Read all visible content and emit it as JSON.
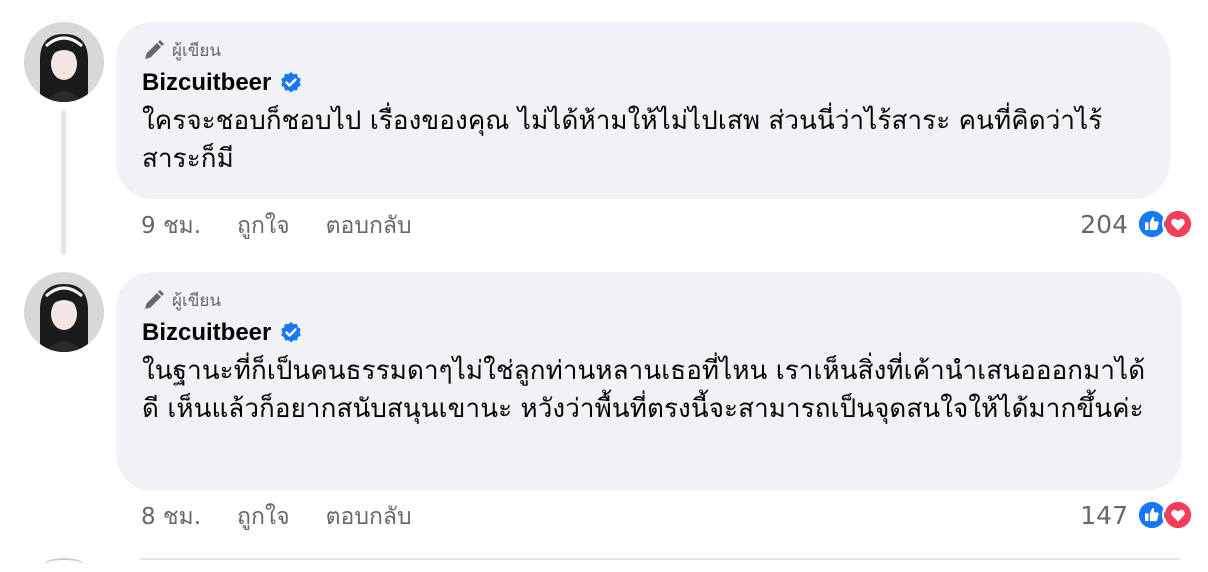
{
  "comments": [
    {
      "badge": "ผู้เขียน",
      "author": "Bizcuitbeer",
      "text": "ใครจะชอบก็ชอบไป เรื่องของคุณ ไม่ได้ห้ามให้ไม่ไปเสพ ส่วนนี่ว่าไร้สาระ คนที่คิดว่าไร้สาระก็มี",
      "time": "9 ชม.",
      "like": "ถูกใจ",
      "reply": "ตอบกลับ",
      "reaction_count": "204"
    },
    {
      "badge": "ผู้เขียน",
      "author": "Bizcuitbeer",
      "text": "ในฐานะที่ก็เป็นคนธรรมดาๆไม่ใช่ลูกท่านหลานเธอที่ไหน เราเห็นสิ่งที่เค้านำเสนอออกมาได้ดี เห็นแล้วก็อยากสนับสนุนเขานะ หวังว่าพื้นที่ตรงนี้จะสามารถเป็นจุดสนใจให้ได้มากขึ้นค่ะ",
      "time": "8 ชม.",
      "like": "ถูกใจ",
      "reply": "ตอบกลับ",
      "reaction_count": "147"
    }
  ],
  "icons": {
    "badge": "pen-icon",
    "verified": "verified-badge-icon",
    "reactions": [
      "like-reaction-icon",
      "love-reaction-icon"
    ]
  },
  "colors": {
    "bubble": "#f0f2f5",
    "secondary_text": "#65676b",
    "verified": "#1877f2",
    "like": "#1877f2",
    "love": "#f33e58"
  }
}
